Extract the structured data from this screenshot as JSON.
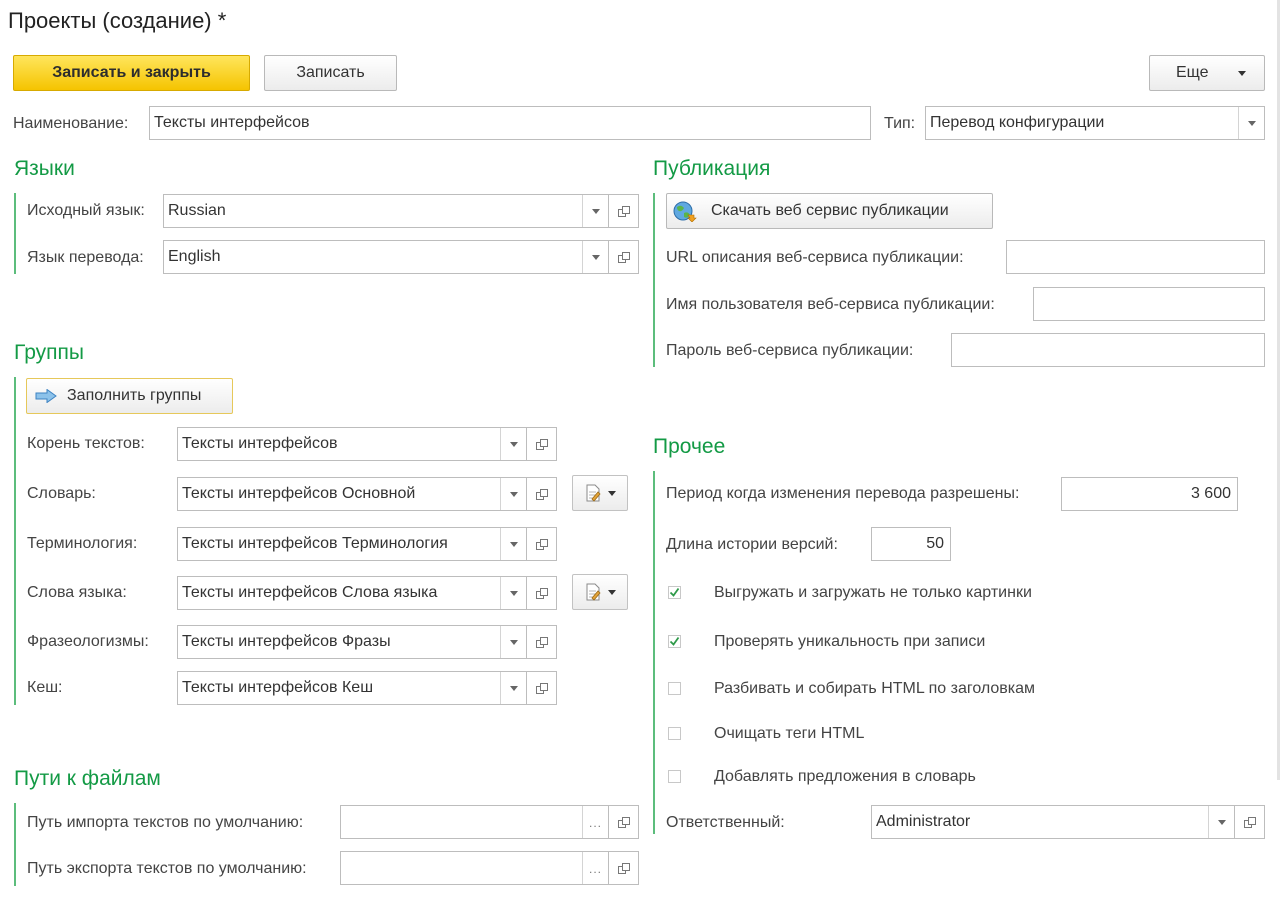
{
  "header": {
    "title": "Проекты (создание) *"
  },
  "toolbar": {
    "save_close": "Записать и закрыть",
    "save": "Записать",
    "more": "Еще"
  },
  "top": {
    "name_label": "Наименование:",
    "name_value": "Тексты интерфейсов",
    "type_label": "Тип:",
    "type_value": "Перевод конфигурации"
  },
  "languages": {
    "title": "Языки",
    "source_label": "Исходный язык:",
    "source_value": "Russian",
    "target_label": "Язык перевода:",
    "target_value": "English"
  },
  "groups": {
    "title": "Группы",
    "fill_button": "Заполнить группы",
    "root_label": "Корень текстов:",
    "root_value": "Тексты интерфейсов",
    "dict_label": "Словарь:",
    "dict_value": "Тексты интерфейсов Основной",
    "term_label": "Терминология:",
    "term_value": "Тексты интерфейсов Терминология",
    "words_label": "Слова языка:",
    "words_value": "Тексты интерфейсов Слова языка",
    "phrase_label": "Фразеологизмы:",
    "phrase_value": "Тексты интерфейсов Фразы",
    "cache_label": "Кеш:",
    "cache_value": "Тексты интерфейсов Кеш"
  },
  "paths": {
    "title": "Пути к файлам",
    "import_label": "Путь импорта текстов по умолчанию:",
    "import_value": "",
    "export_label": "Путь экспорта текстов по умолчанию:",
    "export_value": ""
  },
  "publication": {
    "title": "Публикация",
    "download_button": "Скачать веб сервис публикации",
    "url_label": "URL описания веб-сервиса публикации:",
    "url_value": "",
    "user_label": "Имя пользователя веб-сервиса публикации:",
    "user_value": "",
    "password_label": "Пароль веб-сервиса публикации:",
    "password_value": ""
  },
  "other": {
    "title": "Прочее",
    "period_label": "Период когда изменения перевода разрешены:",
    "period_value": "3 600",
    "history_label": "Длина истории версий:",
    "history_value": "50",
    "checkboxes": [
      {
        "label": "Выгружать и загружать не только картинки",
        "checked": true
      },
      {
        "label": "Проверять уникальность при записи",
        "checked": true
      },
      {
        "label": "Разбивать и собирать HTML по заголовкам",
        "checked": false
      },
      {
        "label": "Очищать теги HTML",
        "checked": false
      },
      {
        "label": "Добавлять предложения в словарь",
        "checked": false
      }
    ],
    "responsible_label": "Ответственный:",
    "responsible_value": "Administrator"
  },
  "colors": {
    "section": "#139a45",
    "section_bar": "#5cbd7c",
    "primary_button": "#f5c400",
    "check": "#2f9a4a"
  },
  "icons": {
    "dropdown": "chevron-down-icon",
    "open": "open-form-icon",
    "select": "ellipsis-icon",
    "fill_groups": "arrow-right-icon",
    "download": "globe-icon",
    "dictionary_menu": "document-edit-icon"
  }
}
